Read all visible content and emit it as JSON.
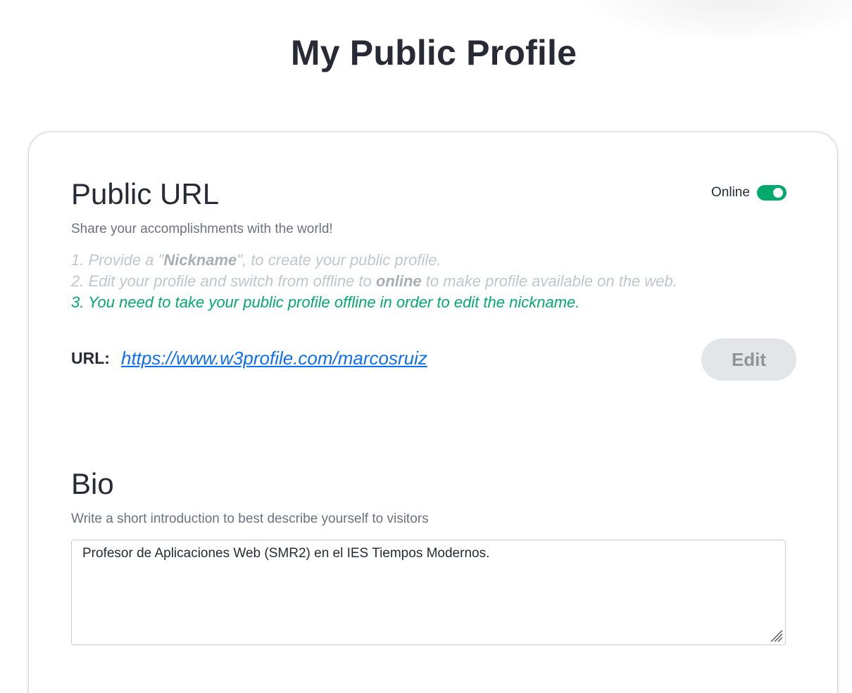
{
  "page": {
    "title": "My Public Profile"
  },
  "public_url": {
    "title": "Public URL",
    "subtitle": "Share your accomplishments with the world!",
    "status_label": "Online",
    "status_on": true,
    "steps": [
      {
        "pre": "1. Provide a \"",
        "bold": "Nickname",
        "post": "\", to create your public profile."
      },
      {
        "pre": "2. Edit your profile and switch from offline to ",
        "bold": "online",
        "post": " to make profile available on the web."
      },
      {
        "pre": "3. You need to take your public profile offline in order to edit the nickname.",
        "bold": "",
        "post": ""
      }
    ],
    "url_label": "URL:",
    "url_value": "https://www.w3profile.com/marcosruiz",
    "edit_label": "Edit"
  },
  "bio": {
    "title": "Bio",
    "subtitle": "Write a short introduction to best describe yourself to visitors",
    "value": "Profesor de Aplicaciones Web (SMR2) en el IES Tiempos Modernos."
  },
  "colors": {
    "accent_green": "#04aa6d",
    "link_blue": "#0d6ef7",
    "text_dark": "#282a35",
    "muted_gray": "#c1c6cc",
    "button_gray": "#e3e6e8"
  }
}
